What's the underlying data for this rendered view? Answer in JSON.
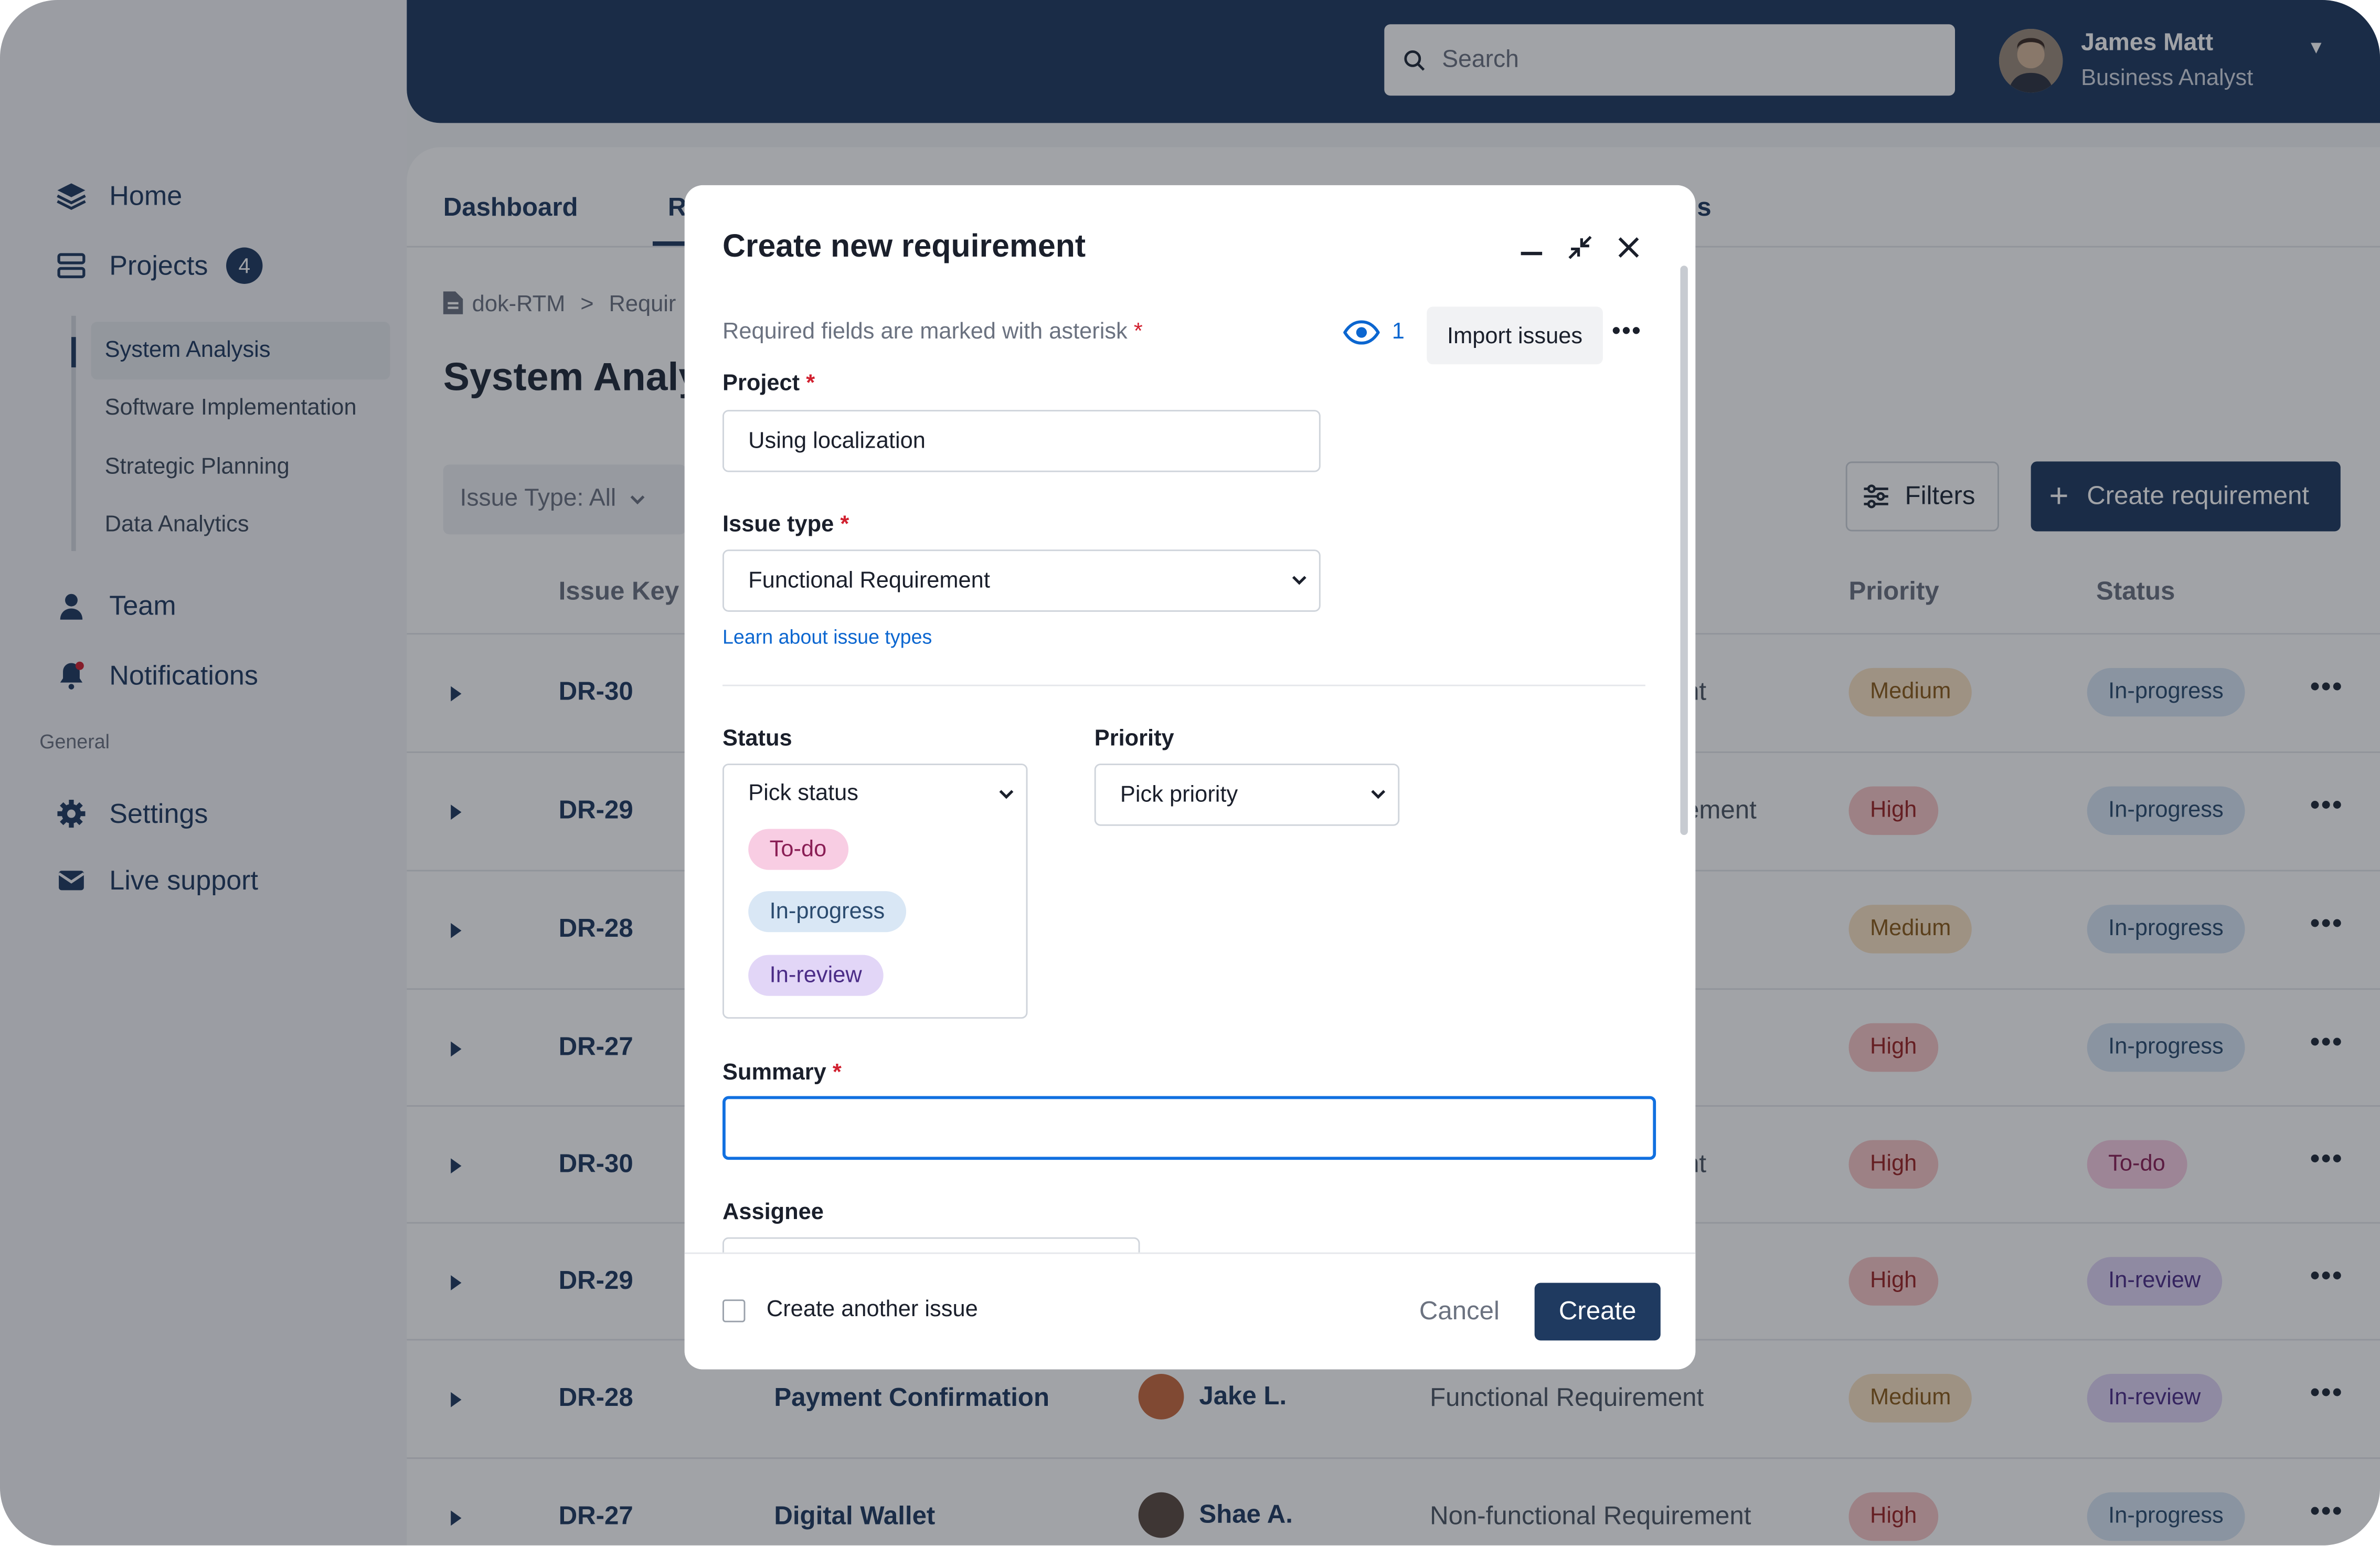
{
  "sidebar": {
    "items": [
      {
        "label": "Home",
        "icon": "layers-icon"
      },
      {
        "label": "Projects",
        "icon": "server-icon",
        "badge": "4"
      },
      {
        "label": "Team",
        "icon": "person-icon"
      },
      {
        "label": "Notifications",
        "icon": "bell-icon"
      },
      {
        "label": "Settings",
        "icon": "gear-icon"
      },
      {
        "label": "Live support",
        "icon": "mail-icon"
      }
    ],
    "sub_items": [
      "System Analysis",
      "Software Implementation",
      "Strategic Planning",
      "Data Analytics"
    ],
    "section_label": "General"
  },
  "header": {
    "search_placeholder": "Search",
    "user_name": "James Matt",
    "user_role": "Business Analyst"
  },
  "tabs": [
    "Dashboard",
    "R",
    "s"
  ],
  "breadcrumb": [
    "dok-RTM",
    "Requir"
  ],
  "page_title": "System Analy",
  "toolbar": {
    "issue_filter": "Issue Type: All",
    "filters_label": "Filters",
    "create_label": "Create requirement"
  },
  "columns": {
    "key": "Issue Key",
    "priority": "Priority",
    "status": "Status"
  },
  "rows": [
    {
      "key": "DR-30",
      "title": "",
      "assignee": "",
      "type": "nt",
      "priority": "Medium",
      "status": "In-progress"
    },
    {
      "key": "DR-29",
      "title": "",
      "assignee": "",
      "type": "ement",
      "priority": "High",
      "status": "In-progress"
    },
    {
      "key": "DR-28",
      "title": "",
      "assignee": "",
      "type": "t",
      "priority": "Medium",
      "status": "In-progress"
    },
    {
      "key": "DR-27",
      "title": "",
      "assignee": "",
      "type": "t",
      "priority": "High",
      "status": "In-progress"
    },
    {
      "key": "DR-30",
      "title": "",
      "assignee": "",
      "type": "nt",
      "priority": "High",
      "status": "To-do"
    },
    {
      "key": "DR-29",
      "title": "",
      "assignee": "",
      "type": "",
      "priority": "High",
      "status": "In-review"
    },
    {
      "key": "DR-28",
      "title": "Payment Confirmation",
      "assignee": "Jake L.",
      "type": "Functional Requirement",
      "priority": "Medium",
      "status": "In-review"
    },
    {
      "key": "DR-27",
      "title": "Digital Wallet",
      "assignee": "Shae A.",
      "type": "Non-functional Requirement",
      "priority": "High",
      "status": "In-progress"
    }
  ],
  "modal": {
    "title": "Create new requirement",
    "required_note": "Required fields are marked with asterisk",
    "watchers": "1",
    "import_label": "Import issues",
    "project_label": "Project",
    "project_value": "Using localization",
    "issue_type_label": "Issue type",
    "issue_type_value": "Functional Requirement",
    "learn_link": "Learn about issue types",
    "status_label": "Status",
    "status_placeholder": "Pick status",
    "status_options": [
      "To-do",
      "In-progress",
      "In-review"
    ],
    "priority_label": "Priority",
    "priority_placeholder": "Pick priority",
    "summary_label": "Summary",
    "summary_value": "",
    "assignee_label": "Assignee",
    "another_label": "Create another issue",
    "cancel_label": "Cancel",
    "create_label": "Create"
  },
  "colors": {
    "brand": "#1f3a60",
    "link": "#0b66d0",
    "required": "#d1202f",
    "focus": "#1170e0"
  }
}
